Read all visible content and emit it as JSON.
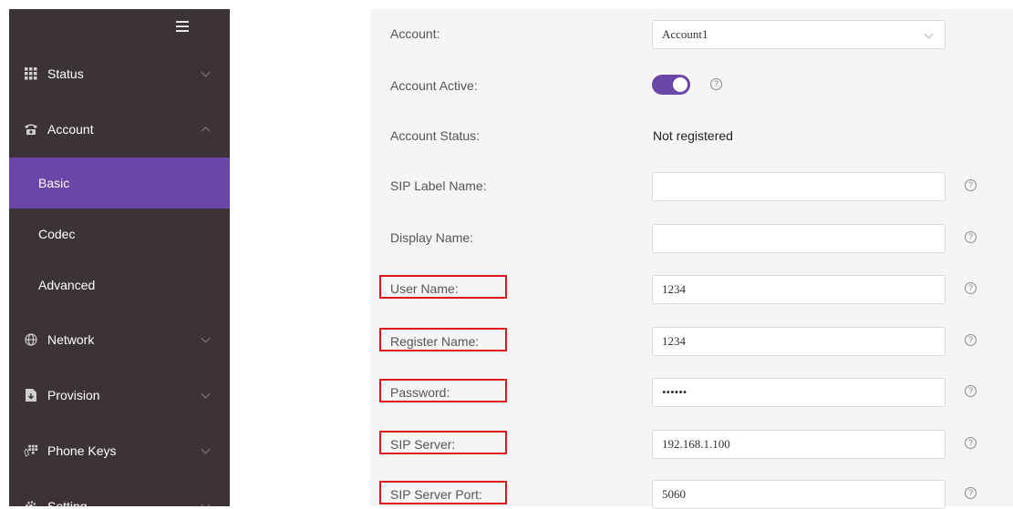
{
  "sidebar": {
    "menu": [
      {
        "label": "Status",
        "icon": "grid-icon"
      },
      {
        "label": "Account",
        "icon": "phone-icon"
      },
      {
        "label": "Network",
        "icon": "globe-icon"
      },
      {
        "label": "Provision",
        "icon": "download-icon"
      },
      {
        "label": "Phone Keys",
        "icon": "keypad-icon"
      },
      {
        "label": "Setting",
        "icon": "gear-icon"
      }
    ],
    "account_sub": [
      {
        "label": "Basic",
        "active": true
      },
      {
        "label": "Codec",
        "active": false
      },
      {
        "label": "Advanced",
        "active": false
      }
    ]
  },
  "form": {
    "account": {
      "label": "Account:",
      "value": "Account1"
    },
    "account_active": {
      "label": "Account Active:",
      "on": true
    },
    "account_status": {
      "label": "Account Status:",
      "value": "Not registered"
    },
    "sip_label_name": {
      "label": "SIP Label Name:",
      "value": ""
    },
    "display_name": {
      "label": "Display Name:",
      "value": ""
    },
    "user_name": {
      "label": "User Name:",
      "value": "1234"
    },
    "register_name": {
      "label": "Register Name:",
      "value": "1234"
    },
    "password": {
      "label": "Password:",
      "value": "••••••"
    },
    "sip_server": {
      "label": "SIP Server:",
      "value": "192.168.1.100"
    },
    "sip_server_port": {
      "label": "SIP Server Port:",
      "value": "5060"
    }
  },
  "help_glyph": "?",
  "colors": {
    "sidebar_bg": "#3b3338",
    "active_bg": "#6a47a6",
    "toggle_on": "#6a47a6",
    "highlight_box": "#e0141e"
  }
}
